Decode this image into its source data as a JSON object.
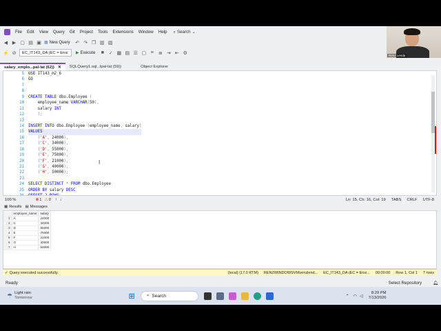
{
  "menu": [
    "File",
    "Edit",
    "View",
    "Query",
    "Git",
    "Project",
    "Tools",
    "Extensions",
    "Window",
    "Help"
  ],
  "search_label": "Search",
  "toolbar": {
    "new_query": "New Query",
    "connection": "EC_IT143_DA (EC = Ensi",
    "execute": "Execute"
  },
  "tabs": [
    {
      "label": "salary_emplo...pal-lat (62))",
      "active": true
    },
    {
      "label": "SQLQuery1.sql...lpal-lat (59))",
      "active": false
    },
    {
      "label": "Object Explorer",
      "active": false
    }
  ],
  "code_lines": [
    {
      "n": "5",
      "html": "<span class=\"kw\">USE</span> IT143_m2_6"
    },
    {
      "n": "6",
      "html": "<span class=\"kw\">GO</span>"
    },
    {
      "n": "7",
      "html": ""
    },
    {
      "n": "8",
      "html": ""
    },
    {
      "n": "9",
      "html": "<span class=\"kw\">CREATE TABLE</span> dbo.Employee <span class=\"gr\">(</span>"
    },
    {
      "n": "10",
      "html": "    employee_name <span class=\"kw\">VARCHAR</span><span class=\"gr\">(</span>50<span class=\"gr\">),</span>"
    },
    {
      "n": "11",
      "html": "    salary <span class=\"kw\">INT</span>"
    },
    {
      "n": "12",
      "html": "    <span class=\"gr\">);</span>"
    },
    {
      "n": "13",
      "html": ""
    },
    {
      "n": "14",
      "html": "<span class=\"kw\">INSERT INTO</span> dbo.Employee <span class=\"gr\">(</span>employee_name<span class=\"gr\">,</span> salary<span class=\"gr\">)</span>"
    },
    {
      "n": "15",
      "html": "<span class=\"kw\">VALUES</span>"
    },
    {
      "n": "16",
      "html": "    <span class=\"gr\">(</span><span class=\"str\">'A'</span><span class=\"gr\">,</span> 24000<span class=\"gr\">),</span>"
    },
    {
      "n": "17",
      "html": "    <span class=\"gr\">(</span><span class=\"str\">'C'</span><span class=\"gr\">,</span> 34000<span class=\"gr\">),</span>"
    },
    {
      "n": "18",
      "html": "    <span class=\"gr\">(</span><span class=\"str\">'D'</span><span class=\"gr\">,</span> 55000<span class=\"gr\">),</span>"
    },
    {
      "n": "19",
      "html": "    <span class=\"gr\">(</span><span class=\"str\">'E'</span><span class=\"gr\">,</span> 75000<span class=\"gr\">),</span>"
    },
    {
      "n": "20",
      "html": "    <span class=\"gr\">(</span><span class=\"str\">'F'</span><span class=\"gr\">,</span> 21000<span class=\"gr\">),</span>"
    },
    {
      "n": "21",
      "html": "    <span class=\"gr\">(</span><span class=\"str\">'G'</span><span class=\"gr\">,</span> 40000<span class=\"gr\">),</span>"
    },
    {
      "n": "22",
      "html": "    <span class=\"gr\">(</span><span class=\"str\">'H'</span><span class=\"gr\">,</span> 50000<span class=\"gr\">);</span>"
    },
    {
      "n": "23",
      "html": ""
    },
    {
      "n": "24",
      "html": "<span class=\"kw\">SELECT DISTINCT</span> <span class=\"gr\">*</span> <span class=\"kw\">FROM</span> dbo.Employee"
    },
    {
      "n": "25",
      "html": "<span class=\"kw\">ORDER BY</span> salary <span class=\"kw\">DESC</span>"
    },
    {
      "n": "26",
      "html": "<span class=\"kw\">OFFSET</span> 2 <span class=\"kw\">ROWS</span>"
    }
  ],
  "editor_status": {
    "zoom": "100 %",
    "errors": "1",
    "warnings": "0",
    "position": "Ln: 15, Ch: 16, Col: 19",
    "tabs": "TABS",
    "eol": "CRLF",
    "encoding": "UTF-8"
  },
  "results_tabs": [
    "Results",
    "Messages"
  ],
  "results": {
    "columns": [
      "employee_name",
      "salary"
    ],
    "rows": [
      [
        "1",
        "A",
        "24000"
      ],
      [
        "2",
        "C",
        "34000"
      ],
      [
        "3",
        "D",
        "55000"
      ],
      [
        "4",
        "E",
        "75000"
      ],
      [
        "5",
        "F",
        "21000"
      ],
      [
        "6",
        "G",
        "40000"
      ],
      [
        "7",
        "H",
        "50000"
      ]
    ]
  },
  "query_status": {
    "message": "Query executed successfully.",
    "server": "(local) (17.0 RTM)",
    "user": "RENZWINDOWSVM\\renzlend...",
    "db": "EC_IT143_DA (EC = Ensi...",
    "time": "00:00:00",
    "rows": "Row 1, Col 1",
    "count": "7 rows"
  },
  "ready": "Ready",
  "select_repo": "Select Repository",
  "taskbar": {
    "weather_line1": "Light rain",
    "weather_line2": "Tomorrow",
    "search": "Search",
    "time": "8:29 PM",
    "date": "7/13/2026"
  },
  "webcam_name": "Renz Lenda"
}
